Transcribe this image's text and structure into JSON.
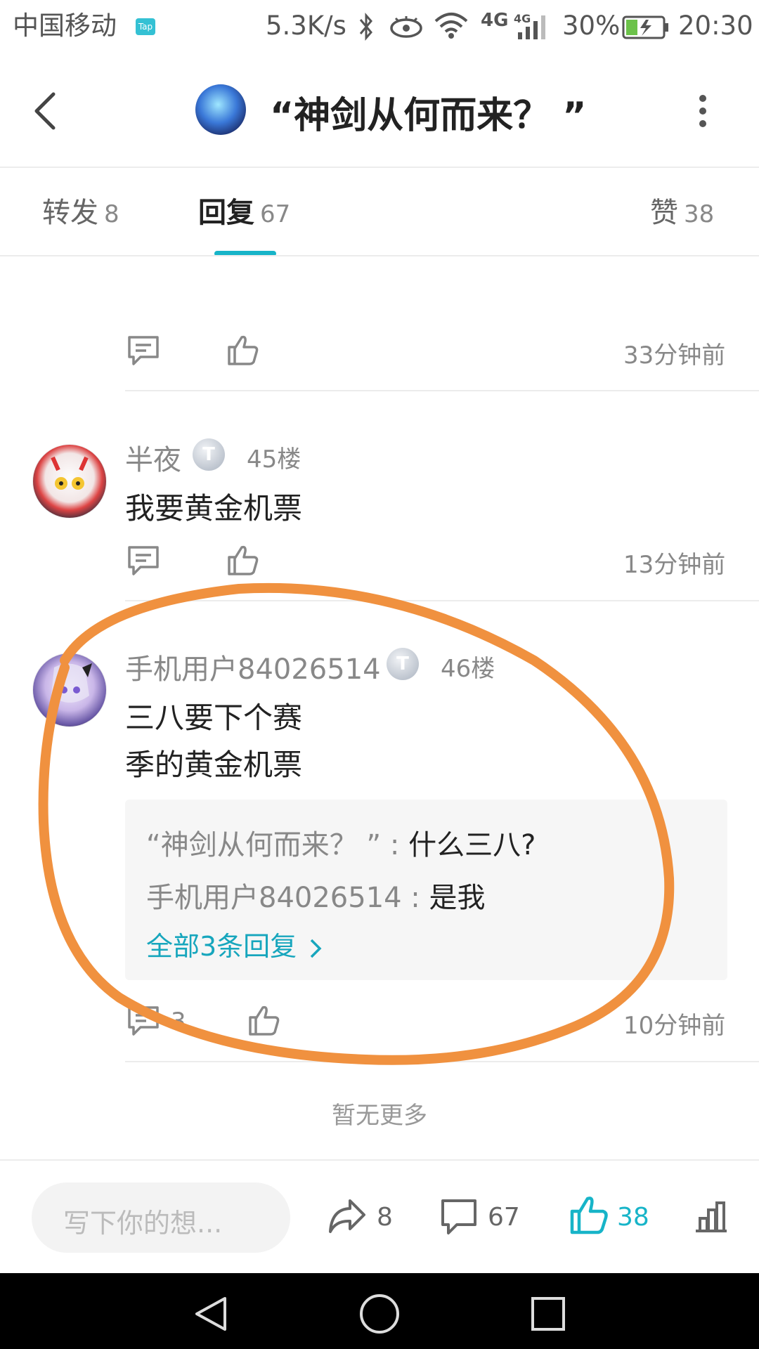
{
  "status_bar": {
    "carrier": "中国移动",
    "tap_badge": "Tap",
    "speed": "5.3K/s",
    "network": "4G",
    "battery": "30%",
    "time": "20:30"
  },
  "header": {
    "title": "“神剑从何而来？ ”"
  },
  "tabs": [
    {
      "label": "转发",
      "count": "8"
    },
    {
      "label": "回复",
      "count": "67"
    },
    {
      "label": "赞",
      "count": "38"
    }
  ],
  "comments": [
    {
      "time": "33分钟前"
    },
    {
      "username": "半夜",
      "badge": "T",
      "floor": "45楼",
      "text": "我要黄金机票",
      "time": "13分钟前"
    },
    {
      "username": "手机用户84026514",
      "badge": "T",
      "floor": "46楼",
      "text_lines": [
        "三八要下个赛",
        "季的黄金机票"
      ],
      "replies": [
        {
          "who": "“神剑从何而来？ ” :",
          "what": "什么三八?"
        },
        {
          "who": "手机用户84026514 :",
          "what": "是我"
        }
      ],
      "more_replies": "全部3条回复",
      "reply_count": "3",
      "time": "10分钟前"
    }
  ],
  "no_more": "暂无更多",
  "bottom_bar": {
    "input_placeholder": "写下你的想...",
    "share_count": "8",
    "comment_count": "67",
    "like_count": "38"
  },
  "colors": {
    "accent": "#17b4c8",
    "annotation": "#f0913f"
  }
}
